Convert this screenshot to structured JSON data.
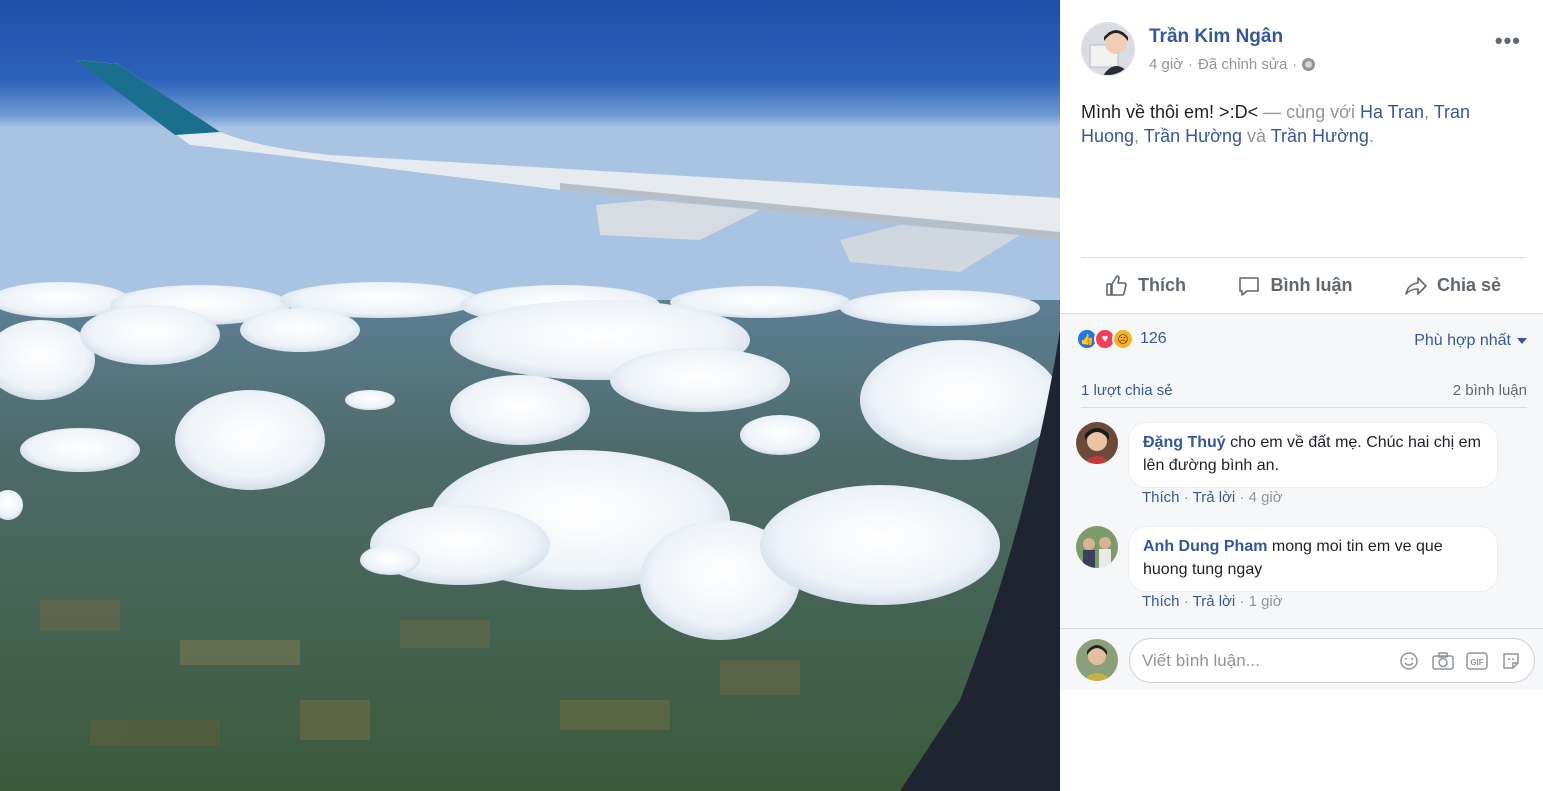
{
  "post": {
    "author": "Trần Kim Ngân",
    "time": "4 giờ",
    "edited": "Đã chỉnh sửa",
    "sep": "·",
    "more": "•••",
    "text": "Mình về thôi em! >:D<",
    "with_prefix": "— cùng với",
    "tags": [
      "Ha Tran",
      "Tran Huong",
      "Trần Hường",
      "Trần Hường"
    ],
    "comma": ",",
    "and_word": "và",
    "period": "."
  },
  "actions": {
    "like": "Thích",
    "comment": "Bình luận",
    "share": "Chia sẻ"
  },
  "reactions": {
    "count": "126",
    "types": [
      "like",
      "love",
      "sad"
    ],
    "sort_label": "Phù hợp nhất"
  },
  "stats": {
    "shares": "1 lượt chia sẻ",
    "comments": "2 bình luận"
  },
  "comments": [
    {
      "name": "Đặng Thuý",
      "text": "cho em về đất mẹ. Chúc hai chị em lên đường bình an.",
      "like": "Thích",
      "reply": "Trả lời",
      "time": "4 giờ"
    },
    {
      "name": "Anh Dung Pham",
      "text": "mong moi tin em ve que huong tung ngay",
      "like": "Thích",
      "reply": "Trả lời",
      "time": "1 giờ"
    }
  ],
  "composer": {
    "placeholder": "Viết bình luận...",
    "icons": [
      "emoji-icon",
      "camera-icon",
      "gif-icon",
      "sticker-icon"
    ]
  },
  "colors": {
    "link": "#365899",
    "muted": "#90949c",
    "sky": "#2e63b8"
  }
}
